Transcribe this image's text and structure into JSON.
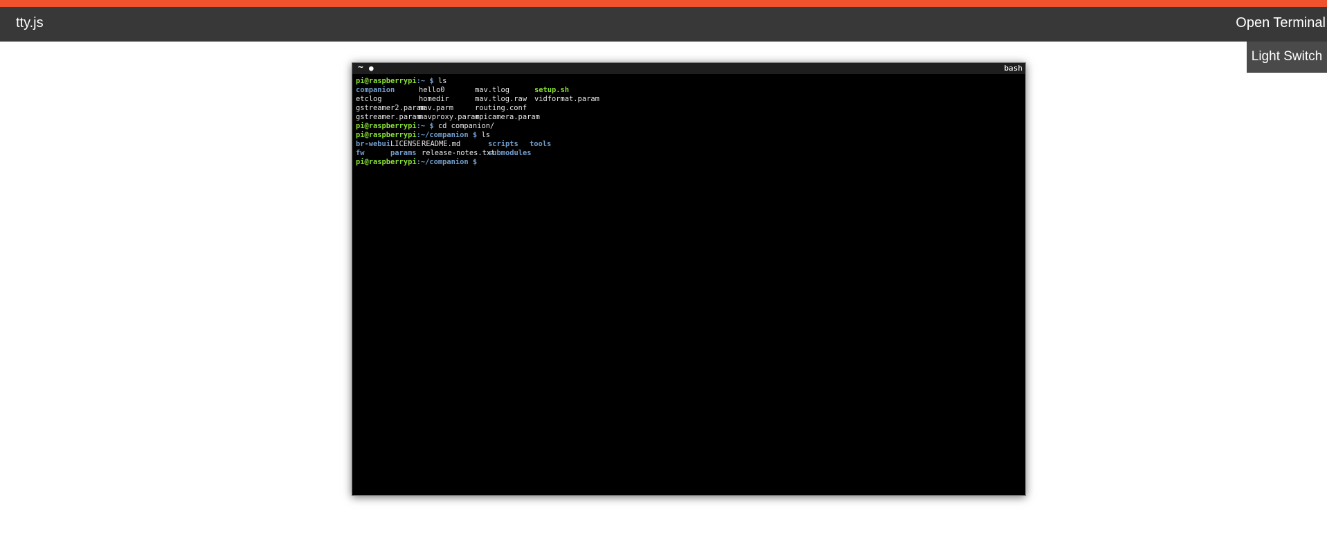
{
  "header": {
    "app_title": "tty.js",
    "open_terminal_label": "Open Terminal",
    "light_switch_label": "Light Switch"
  },
  "terminal": {
    "tab_tilde": "~",
    "tab_dot": "●",
    "shell_name": "bash",
    "lines": {
      "l0": {
        "user": "pi@raspberrypi",
        "path": ":~ $",
        "cmd": " ls"
      },
      "l1": {
        "c1": "companion",
        "c2": "hello0",
        "c3": "mav.tlog",
        "c4": "setup.sh"
      },
      "l2": {
        "c1": "etclog",
        "c2": "homedir",
        "c3": "mav.tlog.raw",
        "c4": "vidformat.param"
      },
      "l3": {
        "c1": "gstreamer2.param",
        "c2": "mav.parm",
        "c3": "routing.conf"
      },
      "l4": {
        "c1": "gstreamer.param",
        "c2": "mavproxy.param",
        "c3": "rpicamera.param"
      },
      "l5": {
        "user": "pi@raspberrypi",
        "path": ":~ $",
        "cmd": " cd companion/"
      },
      "l6": {
        "user": "pi@raspberrypi",
        "path": ":~/companion $",
        "cmd": " ls"
      },
      "l7": {
        "c1": "br-webui",
        "c2": "LICENSE",
        "c3": "README.md",
        "c4": "scripts",
        "c5": "tools"
      },
      "l8": {
        "c1": "fw",
        "c2": "params",
        "c3": "release-notes.txt",
        "c4": "submodules"
      },
      "l9": {
        "user": "pi@raspberrypi",
        "path": ":~/companion $",
        "cmd": ""
      }
    }
  },
  "colors": {
    "accent": "#f0522e",
    "header_bg": "#383838",
    "prompt_user": "#8ae234",
    "directory": "#729fcf"
  }
}
